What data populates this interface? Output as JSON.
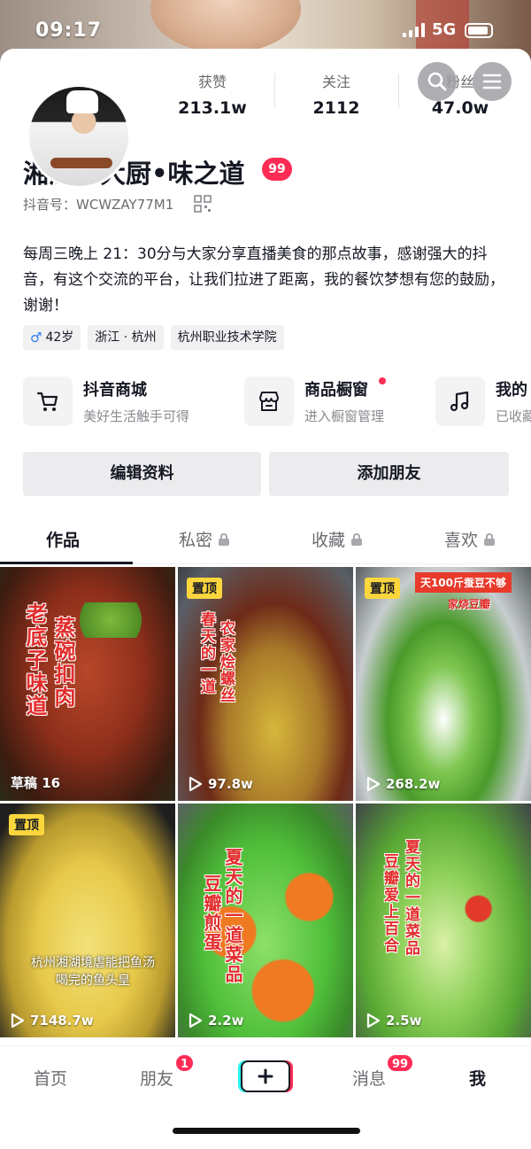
{
  "status_bar": {
    "time": "09:17",
    "network": "5G"
  },
  "profile": {
    "name": "湘湖王大厨•味之道",
    "badge": "99",
    "douyin_id_label": "抖音号：",
    "douyin_id": "WCWZAY77M1",
    "stats": [
      {
        "label": "获赞",
        "value": "213.1w"
      },
      {
        "label": "关注",
        "value": "2112"
      },
      {
        "label": "粉丝",
        "value": "47.0w"
      }
    ],
    "bio": "每周三晚上 21：30分与大家分享直播美食的那点故事，感谢强大的抖音，有这个交流的平台，让我们拉进了距离，我的餐饮梦想有您的鼓励，谢谢！",
    "tags": {
      "age": "42岁",
      "location": "浙江 · 杭州",
      "school": "杭州职业技术学院"
    }
  },
  "services": [
    {
      "title": "抖音商城",
      "subtitle": "美好生活触手可得",
      "icon": "cart-icon"
    },
    {
      "title": "商品橱窗",
      "subtitle": "进入橱窗管理",
      "icon": "shop-icon"
    },
    {
      "title": "我的",
      "subtitle": "已收藏",
      "icon": "music-icon"
    }
  ],
  "buttons": {
    "edit_profile": "编辑资料",
    "add_friend": "添加朋友"
  },
  "tabs": [
    {
      "label": "作品",
      "locked": false
    },
    {
      "label": "私密",
      "locked": true
    },
    {
      "label": "收藏",
      "locked": true
    },
    {
      "label": "喜欢",
      "locked": true
    }
  ],
  "videos": [
    {
      "draft": "草稿 16",
      "overlay": [
        "老底子味道",
        "蒸碗扣肉"
      ]
    },
    {
      "pinned": "置顶",
      "views": "97.8w",
      "overlay": [
        "春天的一道",
        "农家烩螺丝"
      ]
    },
    {
      "pinned": "置顶",
      "views": "268.2w",
      "banner": "天100斤蚕豆不够",
      "banner2": "家烧豆瓣"
    },
    {
      "pinned": "置顶",
      "views": "7148.7w",
      "caption": "杭州湘湖境虐能把鱼汤喝完的鱼头皇"
    },
    {
      "views": "2.2w",
      "overlay": [
        "夏天的一道菜品",
        "豆瓣煎蛋"
      ]
    },
    {
      "views": "2.5w",
      "overlay": [
        "夏天的一道菜品",
        "豆瓣爱上百合"
      ]
    }
  ],
  "bottom_nav": {
    "home": "首页",
    "friends": "朋友",
    "friends_badge": "1",
    "messages": "消息",
    "messages_badge": "99",
    "me": "我"
  },
  "colors": {
    "accent": "#fe2c55",
    "pin": "#fbd63d",
    "male": "#2f7ff0"
  }
}
